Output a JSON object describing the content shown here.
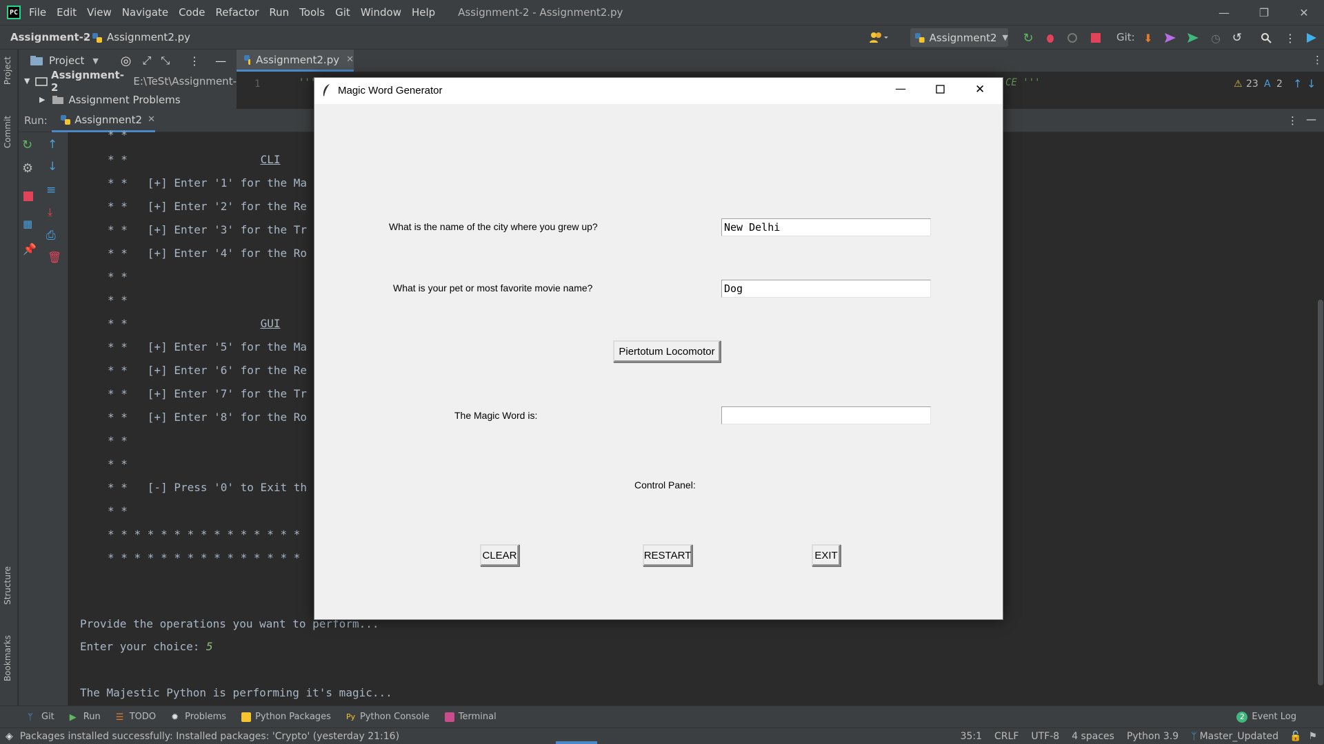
{
  "menu": {
    "items": [
      "File",
      "Edit",
      "View",
      "Navigate",
      "Code",
      "Refactor",
      "Run",
      "Tools",
      "Git",
      "Window",
      "Help"
    ],
    "window_title": "Assignment-2 - Assignment2.py"
  },
  "nav": {
    "project": "Assignment-2",
    "file": "Assignment2.py",
    "run_config": "Assignment2",
    "git_label": "Git:"
  },
  "project_panel": {
    "title": "Project",
    "root_name": "Assignment-2",
    "root_path": "E:\\TeSt\\Assignment-",
    "child": "Assignment Problems"
  },
  "editor": {
    "tab": "Assignment2.py",
    "line_number": "1",
    "warnings": "23",
    "typos": "2",
    "fragment_left": "'''",
    "fragment_right": "CE '''"
  },
  "run_panel": {
    "label": "Run:",
    "tab": "Assignment2"
  },
  "console": {
    "menu_lines": [
      "* *",
      "* *                    CLI",
      "* *   [+] Enter '1' for the Ma",
      "* *   [+] Enter '2' for the Re",
      "* *   [+] Enter '3' for the Tr",
      "* *   [+] Enter '4' for the Ro",
      "* *",
      "* *",
      "* *                    GUI",
      "* *   [+] Enter '5' for the Ma",
      "* *   [+] Enter '6' for the Re",
      "* *   [+] Enter '7' for the Tr",
      "* *   [+] Enter '8' for the Ro",
      "* *",
      "* *",
      "* *   [-] Press '0' to Exit th",
      "* *",
      "* * * * * * * * * * * * * * *",
      "* * * * * * * * * * * * * * *"
    ],
    "prompt": "Provide the operations you want to perform...",
    "choice_label": "Enter your choice: ",
    "choice_value": "5",
    "result": "The Majestic Python is performing it's magic..."
  },
  "tool_tabs": [
    "Git",
    "Run",
    "TODO",
    "Problems",
    "Python Packages",
    "Python Console",
    "Terminal"
  ],
  "event_log": {
    "count": "2",
    "label": "Event Log"
  },
  "status": {
    "message": "Packages installed successfully: Installed packages: 'Crypto' (yesterday 21:16)",
    "position": "35:1",
    "line_sep": "CRLF",
    "encoding": "UTF-8",
    "indent": "4 spaces",
    "interpreter": "Python 3.9",
    "branch": "Master_Updated"
  },
  "side_labels": {
    "project": "Project",
    "commit": "Commit",
    "structure": "Structure",
    "bookmarks": "Bookmarks"
  },
  "tk": {
    "title": "Magic Word Generator",
    "q1": "What is the name of the city where you grew up?",
    "q1_value": "New Delhi",
    "q2": "What is your pet or most favorite movie name?",
    "q2_value": "Dog",
    "generate": "Piertotum Locomotor",
    "result_label": "The Magic Word is:",
    "result_value": "",
    "control_panel": "Control Panel:",
    "clear": "CLEAR",
    "restart": "RESTART",
    "exit": "EXIT"
  },
  "colors": {
    "accent": "#4a9eda",
    "stop": "#e0435a",
    "pycharm_bg": "#2b2b2b",
    "tk_bg": "#f0f0f0"
  }
}
